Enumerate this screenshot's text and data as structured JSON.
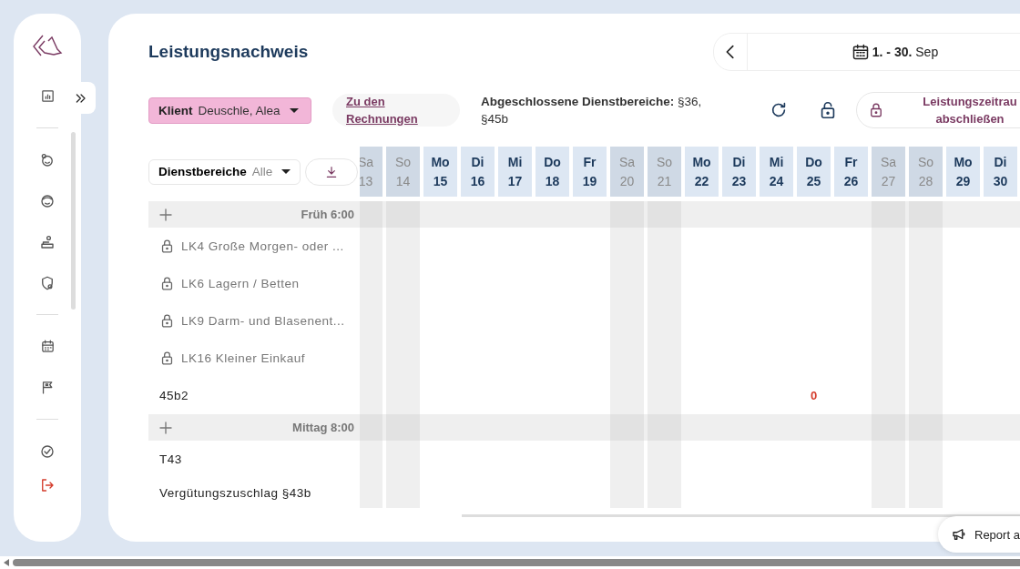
{
  "page": {
    "title": "Leistungsnachweis"
  },
  "date_range": {
    "label": "**1. - 30.** Sep"
  },
  "client_filter": {
    "label": "Klient",
    "value": "Deuschle, Alea"
  },
  "invoices_link": {
    "label": "Zu den Rechnungen"
  },
  "closed_areas": {
    "text": "**Abgeschlossene Dienstbereiche:** §36, §45b"
  },
  "lock_period_button": {
    "lines": [
      "Leistungszeitrau",
      "abschließen"
    ]
  },
  "service_filter": {
    "label": "Dienstbereiche",
    "value": "Alle"
  },
  "days": [
    {
      "weekday": "Sa",
      "date": "13",
      "weekend": true
    },
    {
      "weekday": "So",
      "date": "14",
      "weekend": true
    },
    {
      "weekday": "Mo",
      "date": "15",
      "weekend": false
    },
    {
      "weekday": "Di",
      "date": "16",
      "weekend": false
    },
    {
      "weekday": "Mi",
      "date": "17",
      "weekend": false
    },
    {
      "weekday": "Do",
      "date": "18",
      "weekend": false
    },
    {
      "weekday": "Fr",
      "date": "19",
      "weekend": false
    },
    {
      "weekday": "Sa",
      "date": "20",
      "weekend": true
    },
    {
      "weekday": "So",
      "date": "21",
      "weekend": true
    },
    {
      "weekday": "Mo",
      "date": "22",
      "weekend": false
    },
    {
      "weekday": "Di",
      "date": "23",
      "weekend": false
    },
    {
      "weekday": "Mi",
      "date": "24",
      "weekend": false
    },
    {
      "weekday": "Do",
      "date": "25",
      "weekend": false
    },
    {
      "weekday": "Fr",
      "date": "26",
      "weekend": false
    },
    {
      "weekday": "Sa",
      "date": "27",
      "weekend": true
    },
    {
      "weekday": "So",
      "date": "28",
      "weekend": true
    },
    {
      "weekday": "Mo",
      "date": "29",
      "weekend": false
    },
    {
      "weekday": "Di",
      "date": "30",
      "weekend": false
    }
  ],
  "rows": [
    {
      "kind": "group",
      "label": "Früh 6:00"
    },
    {
      "kind": "task",
      "label": "LK4 Große Morgen- oder ...",
      "locked": true
    },
    {
      "kind": "task",
      "label": "LK6 Lagern / Betten",
      "locked": true
    },
    {
      "kind": "task",
      "label": "LK9 Darm- und Blasenent...",
      "locked": true
    },
    {
      "kind": "task",
      "label": "LK16 Kleiner Einkauf",
      "locked": true
    },
    {
      "kind": "task",
      "label": "45b2",
      "locked": false,
      "cells": [
        null,
        null,
        null,
        null,
        null,
        null,
        null,
        null,
        null,
        null,
        null,
        null,
        "0",
        null,
        null,
        null,
        null,
        null
      ]
    },
    {
      "kind": "group",
      "label": "Mittag 8:00"
    },
    {
      "kind": "task",
      "label": "T43",
      "locked": false
    },
    {
      "kind": "task",
      "label": "Vergütungszuschlag §43b",
      "locked": false
    }
  ],
  "report_button": {
    "label": "Report a"
  }
}
